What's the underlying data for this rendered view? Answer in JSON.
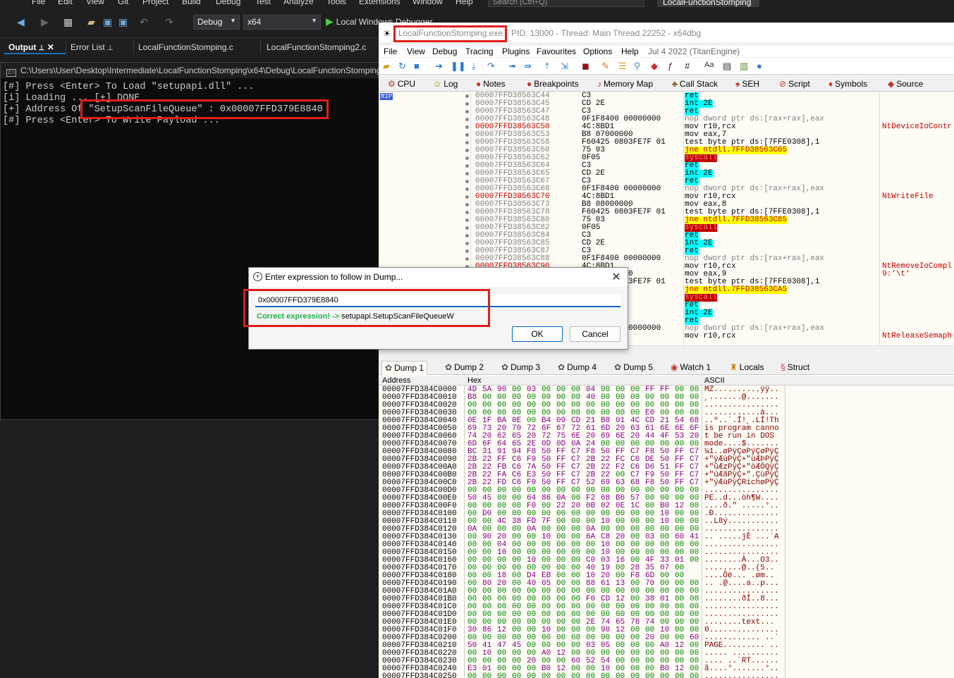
{
  "vs": {
    "menu": [
      "File",
      "Edit",
      "View",
      "Git",
      "Project",
      "Build",
      "Debug",
      "Test",
      "Analyze",
      "Tools",
      "Extensions",
      "Window",
      "Help"
    ],
    "search_placeholder": "Search (Ctrl+Q)",
    "project_title": "LocalFunctionStomping",
    "config": "Debug",
    "platform": "x64",
    "run_label": "Local Windows Debugger",
    "tabs": [
      "Output",
      "Error List",
      "LocalFunctionStomping.c",
      "LocalFunctionStomping2.c"
    ],
    "console_title": "C:\\Users\\User\\Desktop\\Intermediate\\LocalFunctionStomping\\x64\\Debug\\LocalFunctionStomping.exe",
    "console_lines": [
      "[#] Press <Enter> To Load \"setupapi.dll\" ...",
      "[i] Loading ... [+] DONE",
      "[+] Address Of \"SetupScanFileQueue\" : 0x00007FFD379E8840",
      "[#] Press <Enter> To Write Payload ..."
    ]
  },
  "dbg": {
    "title_exe": "LocalFunctionStomping.exe",
    "title_rest": "PID: 13000 - Thread: Main Thread 22252 - x64dbg",
    "menu": [
      "File",
      "View",
      "Debug",
      "Tracing",
      "Plugins",
      "Favourites",
      "Options",
      "Help",
      "Jul 4 2022 (TitanEngine)"
    ],
    "tabs": [
      "CPU",
      "Log",
      "Notes",
      "Breakpoints",
      "Memory Map",
      "Call Stack",
      "SEH",
      "Script",
      "Symbols",
      "Source"
    ],
    "rip_label": "RIP",
    "disasm": [
      {
        "addr": "00007FFD38563C44",
        "bytes": "C3",
        "ins": "ret",
        "k": "ret",
        "com": ""
      },
      {
        "addr": "00007FFD38563C45",
        "bytes": "CD 2E",
        "ins": "int 2E",
        "k": "int",
        "com": ""
      },
      {
        "addr": "00007FFD38563C47",
        "bytes": "C3",
        "ins": "ret",
        "k": "ret",
        "com": ""
      },
      {
        "addr": "00007FFD38563C48",
        "bytes": "0F1F8400 00000000",
        "ins": "nop dword ptr ds:[rax+rax],eax",
        "k": "nop",
        "com": ""
      },
      {
        "addr": "00007FFD38563C50",
        "bytes": "4C:8BD1",
        "ins": "mov r10,rcx",
        "k": "mov",
        "com": "NtDeviceIoContr",
        "hl": true
      },
      {
        "addr": "00007FFD38563C53",
        "bytes": "B8 07000000",
        "ins": "mov eax,7",
        "k": "mov",
        "com": ""
      },
      {
        "addr": "00007FFD38563C58",
        "bytes": "F60425 0803FE7F 01",
        "ins": "test byte ptr ds:[7FFE0308],1",
        "k": "test",
        "com": ""
      },
      {
        "addr": "00007FFD38563C60",
        "bytes": "75 03",
        "ins": "jne ntdll.7FFD38563C65",
        "k": "jne",
        "com": ""
      },
      {
        "addr": "00007FFD38563C62",
        "bytes": "0F05",
        "ins": "syscall",
        "k": "sys",
        "com": ""
      },
      {
        "addr": "00007FFD38563C64",
        "bytes": "C3",
        "ins": "ret",
        "k": "ret",
        "com": ""
      },
      {
        "addr": "00007FFD38563C65",
        "bytes": "CD 2E",
        "ins": "int 2E",
        "k": "int",
        "com": ""
      },
      {
        "addr": "00007FFD38563C67",
        "bytes": "C3",
        "ins": "ret",
        "k": "ret",
        "com": ""
      },
      {
        "addr": "00007FFD38563C68",
        "bytes": "0F1F8400 00000000",
        "ins": "nop dword ptr ds:[rax+rax],eax",
        "k": "nop",
        "com": ""
      },
      {
        "addr": "00007FFD38563C70",
        "bytes": "4C:8BD1",
        "ins": "mov r10,rcx",
        "k": "mov",
        "com": "NtWriteFile",
        "hl": true
      },
      {
        "addr": "00007FFD38563C73",
        "bytes": "B8 08000000",
        "ins": "mov eax,8",
        "k": "mov",
        "com": ""
      },
      {
        "addr": "00007FFD38563C78",
        "bytes": "F60425 0803FE7F 01",
        "ins": "test byte ptr ds:[7FFE0308],1",
        "k": "test",
        "com": ""
      },
      {
        "addr": "00007FFD38563C80",
        "bytes": "75 03",
        "ins": "jne ntdll.7FFD38563C85",
        "k": "jne",
        "com": ""
      },
      {
        "addr": "00007FFD38563C82",
        "bytes": "0F05",
        "ins": "syscall",
        "k": "sys",
        "com": ""
      },
      {
        "addr": "00007FFD38563C84",
        "bytes": "C3",
        "ins": "ret",
        "k": "ret",
        "com": ""
      },
      {
        "addr": "00007FFD38563C85",
        "bytes": "CD 2E",
        "ins": "int 2E",
        "k": "int",
        "com": ""
      },
      {
        "addr": "00007FFD38563C87",
        "bytes": "C3",
        "ins": "ret",
        "k": "ret",
        "com": ""
      },
      {
        "addr": "00007FFD38563C88",
        "bytes": "0F1F8400 00000000",
        "ins": "nop dword ptr ds:[rax+rax],eax",
        "k": "nop",
        "com": ""
      },
      {
        "addr": "00007FFD38563C90",
        "bytes": "4C:8BD1",
        "ins": "mov r10,rcx",
        "k": "mov",
        "com": "NtRemoveIoCompl",
        "hl": true
      },
      {
        "addr": "00007FFD38563C93",
        "bytes": "B8 09000000",
        "ins": "mov eax,9",
        "k": "mov",
        "com": "9:'\\t'"
      },
      {
        "addr": "00007FFD38563C98",
        "bytes": "F60425 0803FE7F 01",
        "ins": "test byte ptr ds:[7FFE0308],1",
        "k": "test",
        "com": ""
      },
      {
        "addr": "00007FFD38563CA0",
        "bytes": "75 03",
        "ins": "jne ntdll.7FFD38563CA5",
        "k": "jne",
        "com": ""
      },
      {
        "addr": "00007FFD38563CA2",
        "bytes": "0F05",
        "ins": "syscall",
        "k": "sys",
        "com": ""
      },
      {
        "addr": "00007FFD38563CA4",
        "bytes": "C3",
        "ins": "ret",
        "k": "ret",
        "com": ""
      },
      {
        "addr": "00007FFD38563CA5",
        "bytes": "CD 2E",
        "ins": "int 2E",
        "k": "int",
        "com": ""
      },
      {
        "addr": "00007FFD38563CA7",
        "bytes": "C3",
        "ins": "ret",
        "k": "ret",
        "com": ""
      },
      {
        "addr": "00007FFD38563CA8",
        "bytes": "0F1F8400 00000000",
        "ins": "nop dword ptr ds:[rax+rax],eax",
        "k": "nop",
        "com": ""
      },
      {
        "addr": "00007FFD38563CB0",
        "bytes": "4C:8BD1",
        "ins": "mov r10,rcx",
        "k": "mov",
        "com": "NtReleaseSemaph",
        "hl": true
      }
    ],
    "dump_tabs": [
      "Dump 1",
      "Dump 2",
      "Dump 3",
      "Dump 4",
      "Dump 5",
      "Watch 1",
      "Locals",
      "Struct"
    ],
    "dump_headers": {
      "address": "Address",
      "hex": "Hex",
      "ascii": "ASCII"
    },
    "dump_rows": [
      [
        "00007FFD384C0000",
        "4D 5A 90 00 03 00 00 00 04 00 00 00 FF FF 00 00",
        "MZ..........ÿÿ.."
      ],
      [
        "00007FFD384C0010",
        "B8 00 00 00 00 00 00 00 40 00 00 00 00 00 00 00",
        "¸.......@......."
      ],
      [
        "00007FFD384C0020",
        "00 00 00 00 00 00 00 00 00 00 00 00 00 00 00 00",
        "................"
      ],
      [
        "00007FFD384C0030",
        "00 00 00 00 00 00 00 00 00 00 00 00 E0 00 00 00",
        "............à..."
      ],
      [
        "00007FFD384C0040",
        "0E 1F BA 0E 00 B4 09 CD 21 B8 01 4C CD 21 54 68",
        "..º..´.Í!¸.LÍ!Th"
      ],
      [
        "00007FFD384C0050",
        "69 73 20 70 72 6F 67 72 61 6D 20 63 61 6E 6E 6F",
        "is program canno"
      ],
      [
        "00007FFD384C0060",
        "74 20 62 65 20 72 75 6E 20 69 6E 20 44 4F 53 20",
        "t be run in DOS "
      ],
      [
        "00007FFD384C0070",
        "6D 6F 64 65 2E 0D 0D 0A 24 00 00 00 00 00 00 00",
        "mode....$......."
      ],
      [
        "00007FFD384C0080",
        "BC 31 91 94 F8 50 FF C7 F8 50 FF C7 F8 50 FF C7",
        "¼1..øPÿÇøPÿÇøPÿÇ"
      ],
      [
        "00007FFD384C0090",
        "2B 22 FF C6 F9 50 FF C7 2B 22 FC C6 DE 50 FF C7",
        "+\"ÿÆùPÿÇ+\"üÆÞPÿÇ"
      ],
      [
        "00007FFD384C00A0",
        "2B 22 FB C6 7A 50 FF C7 2B 22 F2 C6 D6 51 FF C7",
        "+\"ûÆzPÿÇ+\"òÆÖQÿÇ"
      ],
      [
        "00007FFD384C00B0",
        "2B 22 FA C6 E3 50 FF C7 2B 22 00 C7 F9 50 FF C7",
        "+\"úÆãPÿÇ+\".ÇùPÿÇ"
      ],
      [
        "00007FFD384C00C0",
        "2B 22 FD C6 F9 50 FF C7 52 69 63 68 F8 50 FF C7",
        "+\"ýÆùPÿÇRichøPÿÇ"
      ],
      [
        "00007FFD384C00D0",
        "00 00 00 00 00 00 00 00 00 00 00 00 00 00 00 00",
        "................"
      ],
      [
        "00007FFD384C00E0",
        "50 45 00 00 64 86 0A 00 F2 68 B6 57 00 00 00 00",
        "PE..d...òh¶W...."
      ],
      [
        "00007FFD384C00F0",
        "00 00 00 00 F0 00 22 20 0B 02 0E 1C 00 B0 12 00",
        "....ð.\" .....°.."
      ],
      [
        "00007FFD384C0100",
        "00 D0 00 00 00 00 00 00 00 00 00 00 00 10 00 00",
        ".Ð.............."
      ],
      [
        "00007FFD384C0110",
        "00 00 4C 38 FD 7F 00 00 00 10 00 00 00 10 00 00",
        "..L8ý..........."
      ],
      [
        "00007FFD384C0120",
        "0A 00 00 00 0A 00 00 00 0A 00 00 00 00 00 00 00",
        "................"
      ],
      [
        "00007FFD384C0130",
        "00 90 20 00 00 10 00 00 6A C8 20 00 03 00 60 41",
        ".. .....jÈ ...`A"
      ],
      [
        "00007FFD384C0140",
        "00 00 04 00 00 00 00 00 00 10 00 00 00 00 00 00",
        "................"
      ],
      [
        "00007FFD384C0150",
        "00 00 10 00 00 00 00 00 00 10 00 00 00 00 00 00",
        "................"
      ],
      [
        "00007FFD384C0160",
        "00 00 00 00 10 00 00 00 C0 03 16 00 4F 33 01 00",
        "........À...O3.."
      ],
      [
        "00007FFD384C0170",
        "00 00 00 00 00 00 00 00 40 19 00 28 35 07 00",
        "........@..(5.."
      ],
      [
        "00007FFD384C0180",
        "00 00 18 00 D4 EB 00 00 10 20 00 F8 6D 00 00",
        "....Ôë... .øm.."
      ],
      [
        "00007FFD384C0190",
        "00 80 20 00 40 05 00 00 88 61 13 00 70 00 00 00",
        ".. .@....a..p..."
      ],
      [
        "00007FFD384C01A0",
        "00 00 00 00 00 00 00 00 00 00 00 00 00 00 00 00",
        "................"
      ],
      [
        "00007FFD384C01B0",
        "00 00 00 00 00 00 00 00 F0 CD 12 00 38 01 00 00",
        "........ðÍ..8..."
      ],
      [
        "00007FFD384C01C0",
        "00 00 00 00 00 00 00 00 00 00 00 00 00 00 00 00",
        "................"
      ],
      [
        "00007FFD384C01D0",
        "00 00 00 00 00 00 00 00 00 00 00 00 00 00 00 00",
        "................"
      ],
      [
        "00007FFD384C01E0",
        "00 00 00 00 00 00 00 00 2E 74 65 78 74 00 00 00",
        "........text..."
      ],
      [
        "00007FFD384C01F0",
        "30 86 12 00 00 10 00 00 00 90 12 00 00 10 00 00",
        "0..............."
      ],
      [
        "00007FFD384C0200",
        "00 00 00 00 00 00 00 00 00 00 00 00 20 00 00 60",
        "............ ..`"
      ],
      [
        "00007FFD384C0210",
        "50 41 47 45 00 00 00 00 03 05 00 00 00 A0 12 00",
        "PAGE......... .."
      ],
      [
        "00007FFD384C0220",
        "00 10 00 00 00 A0 12 00 00 00 00 00 00 00 00 00",
        "..... .........."
      ],
      [
        "00007FFD384C0230",
        "00 00 00 00 20 00 00 60 52 54 00 00 00 00 00 00",
        ".... ..`RT......"
      ],
      [
        "00007FFD384C0240",
        "E3 01 00 00 00 B0 12 00 00 10 00 00 00 B0 12 00",
        "ã....°.......°.."
      ],
      [
        "00007FFD384C0250",
        "00 00 00 00 00 00 00 00 00 00 00 00 00 00 00 00",
        "................"
      ]
    ]
  },
  "dialog": {
    "title": "Enter expression to follow in Dump...",
    "value": "0x00007FFD379E8840",
    "status_ok": "Correct expression! ->",
    "status_rest": " setupapi.SetupScanFileQueueW",
    "ok_label": "OK",
    "cancel_label": "Cancel",
    "close_glyph": "✕"
  }
}
